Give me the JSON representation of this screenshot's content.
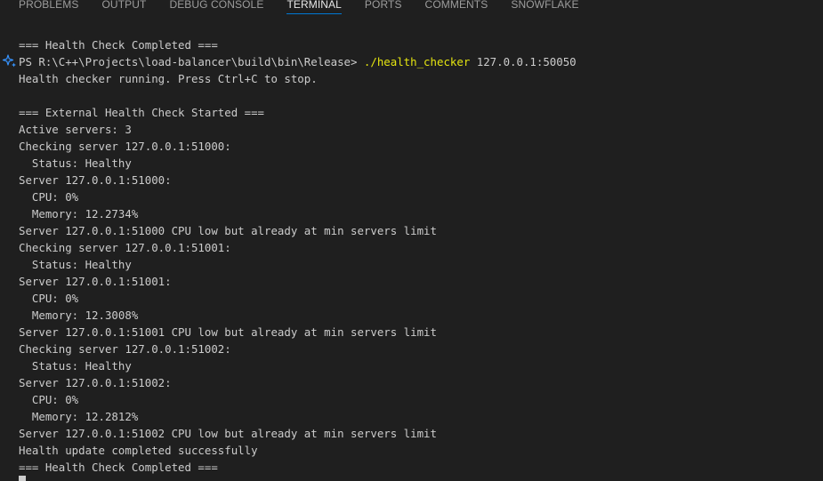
{
  "tabs": [
    {
      "label": "PROBLEMS"
    },
    {
      "label": "OUTPUT"
    },
    {
      "label": "DEBUG CONSOLE"
    },
    {
      "label": "TERMINAL"
    },
    {
      "label": "PORTS"
    },
    {
      "label": "COMMENTS"
    },
    {
      "label": "SNOWFLAKE"
    }
  ],
  "active_tab": "TERMINAL",
  "terminal": {
    "prompt": {
      "path": "PS R:\\C++\\Projects\\load-balancer\\build\\bin\\Release> ",
      "command": "./health_checker",
      "args": " 127.0.0.1:50050"
    },
    "lines": [
      "=== Health Check Completed ===",
      "Health checker running. Press Ctrl+C to stop.",
      "",
      "=== External Health Check Started ===",
      "Active servers: 3",
      "Checking server 127.0.0.1:51000:",
      "  Status: Healthy",
      "Server 127.0.0.1:51000:",
      "  CPU: 0%",
      "  Memory: 12.2734%",
      "Server 127.0.0.1:51000 CPU low but already at min servers limit",
      "Checking server 127.0.0.1:51001:",
      "  Status: Healthy",
      "Server 127.0.0.1:51001:",
      "  CPU: 0%",
      "  Memory: 12.3008%",
      "Server 127.0.0.1:51001 CPU low but already at min servers limit",
      "Checking server 127.0.0.1:51002:",
      "  Status: Healthy",
      "Server 127.0.0.1:51002:",
      "  CPU: 0%",
      "  Memory: 12.2812%",
      "Server 127.0.0.1:51002 CPU low but already at min servers limit",
      "Health update completed successfully",
      "=== Health Check Completed ==="
    ]
  },
  "colors": {
    "background": "#1f1f1f",
    "text": "#cccccc",
    "command": "#e5e510",
    "active_tab_border": "#0078d4",
    "sparkle": "#3794ff"
  }
}
